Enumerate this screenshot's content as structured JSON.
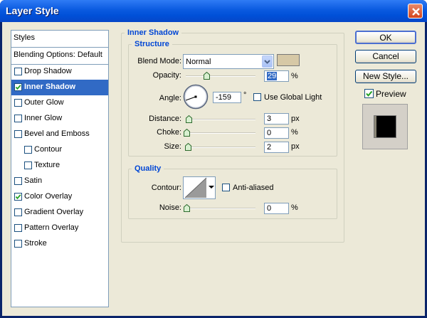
{
  "title": "Layer Style",
  "left_panel": {
    "header": "Styles",
    "items": [
      {
        "label": "Blending Options: Default"
      },
      {
        "label": "Drop Shadow",
        "checked": false
      },
      {
        "label": "Inner Shadow",
        "checked": true,
        "selected": true
      },
      {
        "label": "Outer Glow",
        "checked": false
      },
      {
        "label": "Inner Glow",
        "checked": false
      },
      {
        "label": "Bevel and Emboss",
        "checked": false
      },
      {
        "label": "Contour",
        "checked": false
      },
      {
        "label": "Texture",
        "checked": false
      },
      {
        "label": "Satin",
        "checked": false
      },
      {
        "label": "Color Overlay",
        "checked": true
      },
      {
        "label": "Gradient Overlay",
        "checked": false
      },
      {
        "label": "Pattern Overlay",
        "checked": false
      },
      {
        "label": "Stroke",
        "checked": false
      }
    ]
  },
  "main": {
    "section_title": "Inner Shadow",
    "structure": {
      "title": "Structure",
      "blend_mode_label": "Blend Mode:",
      "blend_mode_value": "Normal",
      "shadow_color": "#d6c8a6",
      "opacity_label": "Opacity:",
      "opacity_value": "29",
      "opacity_unit": "%",
      "opacity_slider": 0.29,
      "angle_label": "Angle:",
      "angle_value": "-159",
      "angle_unit": "°",
      "use_global_light_label": "Use Global Light",
      "use_global_light": false,
      "distance_label": "Distance:",
      "distance_value": "3",
      "distance_unit": "px",
      "choke_label": "Choke:",
      "choke_value": "0",
      "choke_unit": "%",
      "size_label": "Size:",
      "size_value": "2",
      "size_unit": "px"
    },
    "quality": {
      "title": "Quality",
      "contour_label": "Contour:",
      "anti_aliased_label": "Anti-aliased",
      "anti_aliased": false,
      "noise_label": "Noise:",
      "noise_value": "0",
      "noise_unit": "%"
    }
  },
  "buttons": {
    "ok": "OK",
    "cancel": "Cancel",
    "new_style": "New Style...",
    "preview_label": "Preview",
    "preview_checked": true
  },
  "colors": {
    "accent": "#0046d5",
    "selection": "#316ac5",
    "titlebar": "#0a5ae0"
  }
}
